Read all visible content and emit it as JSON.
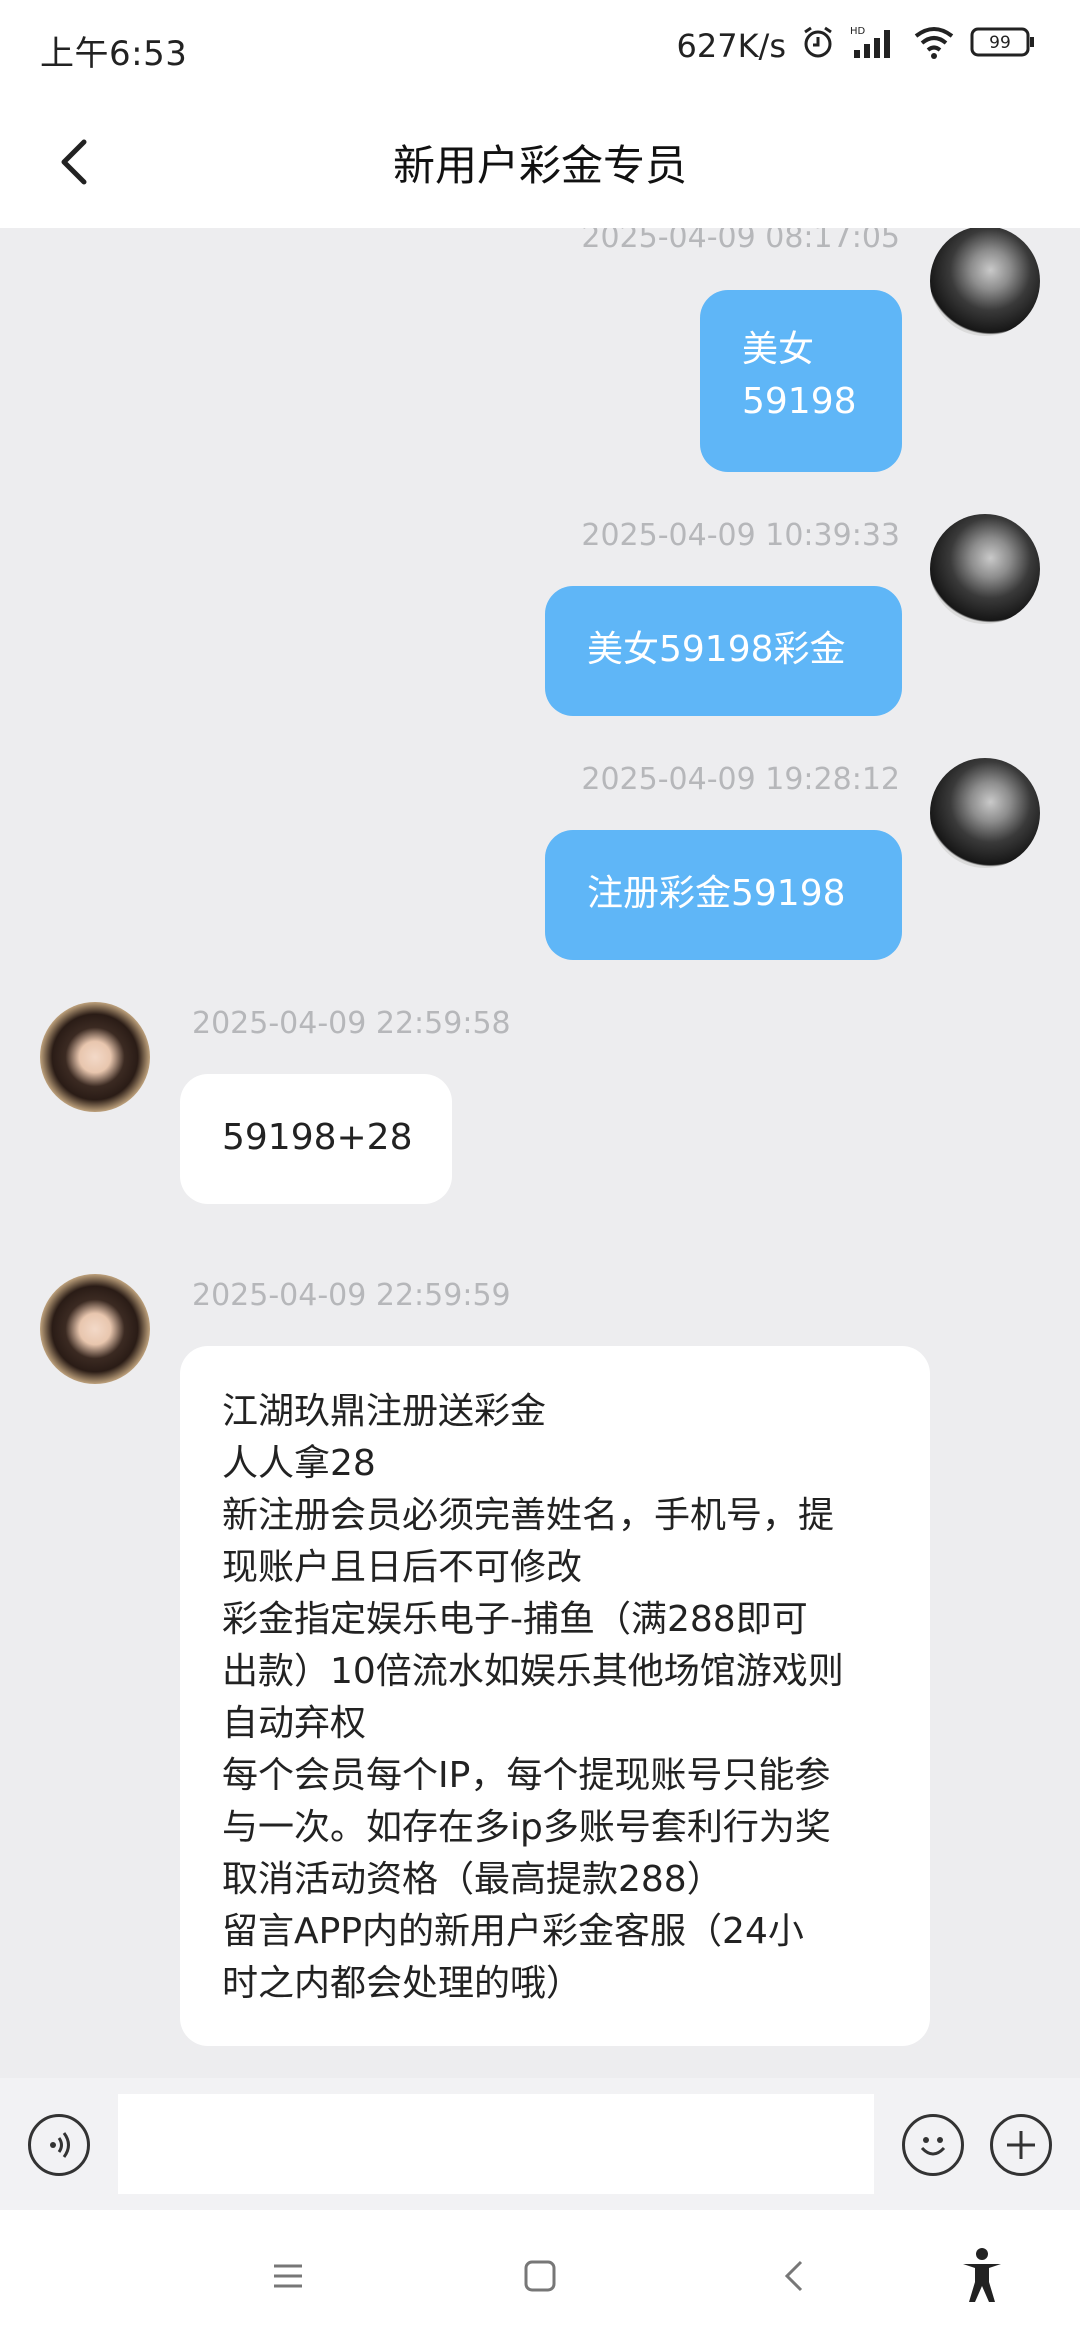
{
  "status_bar": {
    "time": "上午6:53",
    "network_speed": "627K/s",
    "battery": "99",
    "icons": [
      "alarm-icon",
      "hd-signal-icon",
      "wifi-icon",
      "battery-icon"
    ]
  },
  "header": {
    "title": "新用户彩金专员",
    "back_icon": "chevron-left-icon"
  },
  "messages": [
    {
      "direction": "out",
      "timestamp": "2025-04-09 08:17:05",
      "lines": [
        "美女",
        "59198"
      ]
    },
    {
      "direction": "out",
      "timestamp": "2025-04-09 10:39:33",
      "lines": [
        "美女59198彩金"
      ]
    },
    {
      "direction": "out",
      "timestamp": "2025-04-09 19:28:12",
      "lines": [
        "注册彩金59198"
      ]
    },
    {
      "direction": "in",
      "timestamp": "2025-04-09 22:59:58",
      "lines": [
        "59198+28"
      ]
    },
    {
      "direction": "in",
      "timestamp": "2025-04-09 22:59:59",
      "lines": [
        "江湖玖鼎注册送彩金",
        "人人拿28",
        "新注册会员必须完善姓名，手机号，提",
        "现账户且日后不可修改",
        "彩金指定娱乐电子-捕鱼（满288即可",
        "出款）10倍流水如娱乐其他场馆游戏则",
        "自动弃权",
        "每个会员每个IP，每个提现账号只能参",
        "与一次。如存在多ip多账号套利行为奖",
        "取消活动资格（最高提款288）",
        "留言APP内的新用户彩金客服（24小",
        "时之内都会处理的哦）"
      ]
    }
  ],
  "input_bar": {
    "value": "",
    "voice_icon": "voice-icon",
    "emoji_icon": "emoji-icon",
    "plus_icon": "plus-icon"
  },
  "nav_bar": {
    "icons": [
      "menu-icon",
      "home-icon",
      "back-icon",
      "accessibility-icon"
    ]
  },
  "colors": {
    "outgoing_bubble": "#5fb6f7",
    "incoming_bubble": "#ffffff",
    "chat_background": "#ededef",
    "timestamp": "#b6b7ba"
  }
}
